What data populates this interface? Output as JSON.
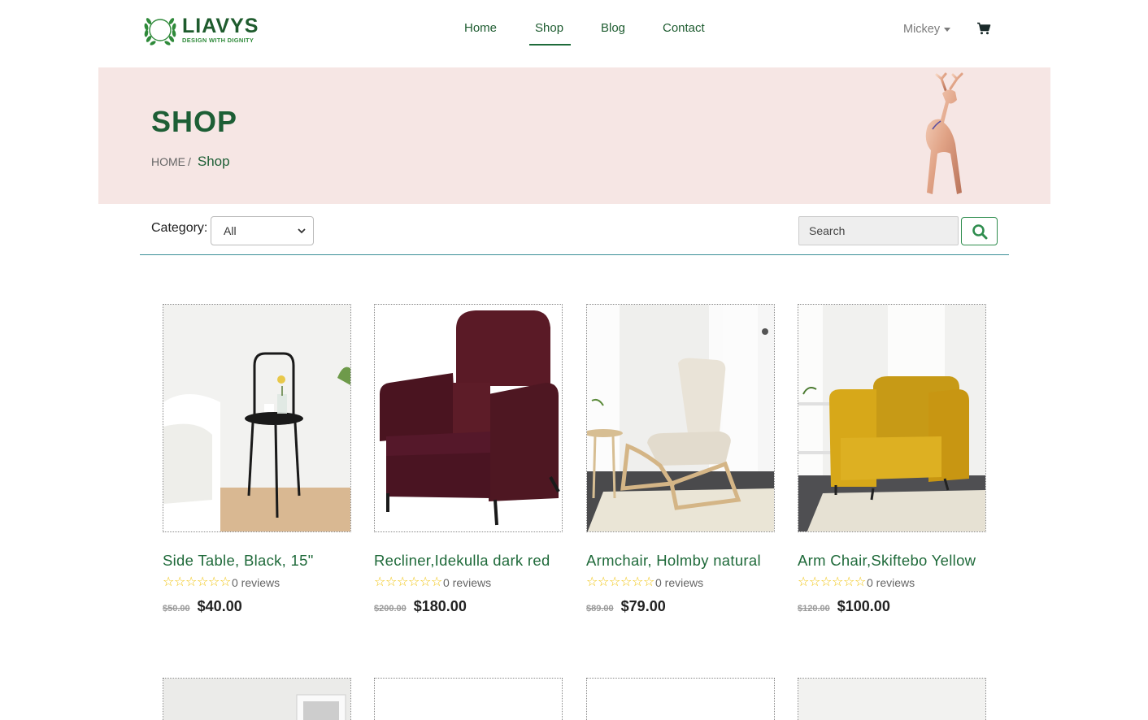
{
  "brand": {
    "name": "LIAVYS",
    "tagline": "DESIGN WITH DIGNITY"
  },
  "nav": {
    "items": [
      "Home",
      "Shop",
      "Blog",
      "Contact"
    ],
    "active": "Shop"
  },
  "user": {
    "name": "Mickey",
    "cart_icon": "cart-icon"
  },
  "banner": {
    "title": "SHOP",
    "breadcrumb_home": "HOME",
    "breadcrumb_sep": "/",
    "breadcrumb_current": "Shop"
  },
  "filter": {
    "category_label": "Category:",
    "category_value": "All",
    "search_placeholder": "Search",
    "search_icon": "search-icon"
  },
  "colors": {
    "brand_green": "#1d5e35",
    "banner_bg": "#f6e6e4",
    "star_yellow": "#f1c40f",
    "divider": "#3a8f98"
  },
  "products": [
    {
      "title": "Side Table, Black, 15\"",
      "reviews": "0 reviews",
      "old_price": "$50.00",
      "price": "$40.00",
      "stars": 0
    },
    {
      "title": "Recliner,Idekulla dark red",
      "reviews": "0 reviews",
      "old_price": "$200.00",
      "price": "$180.00",
      "stars": 0
    },
    {
      "title": "Armchair, Holmby natural",
      "reviews": "0 reviews",
      "old_price": "$89.00",
      "price": "$79.00",
      "stars": 0
    },
    {
      "title": "Arm Chair,Skiftebo Yellow",
      "reviews": "0 reviews",
      "old_price": "$120.00",
      "price": "$100.00",
      "stars": 0
    }
  ]
}
